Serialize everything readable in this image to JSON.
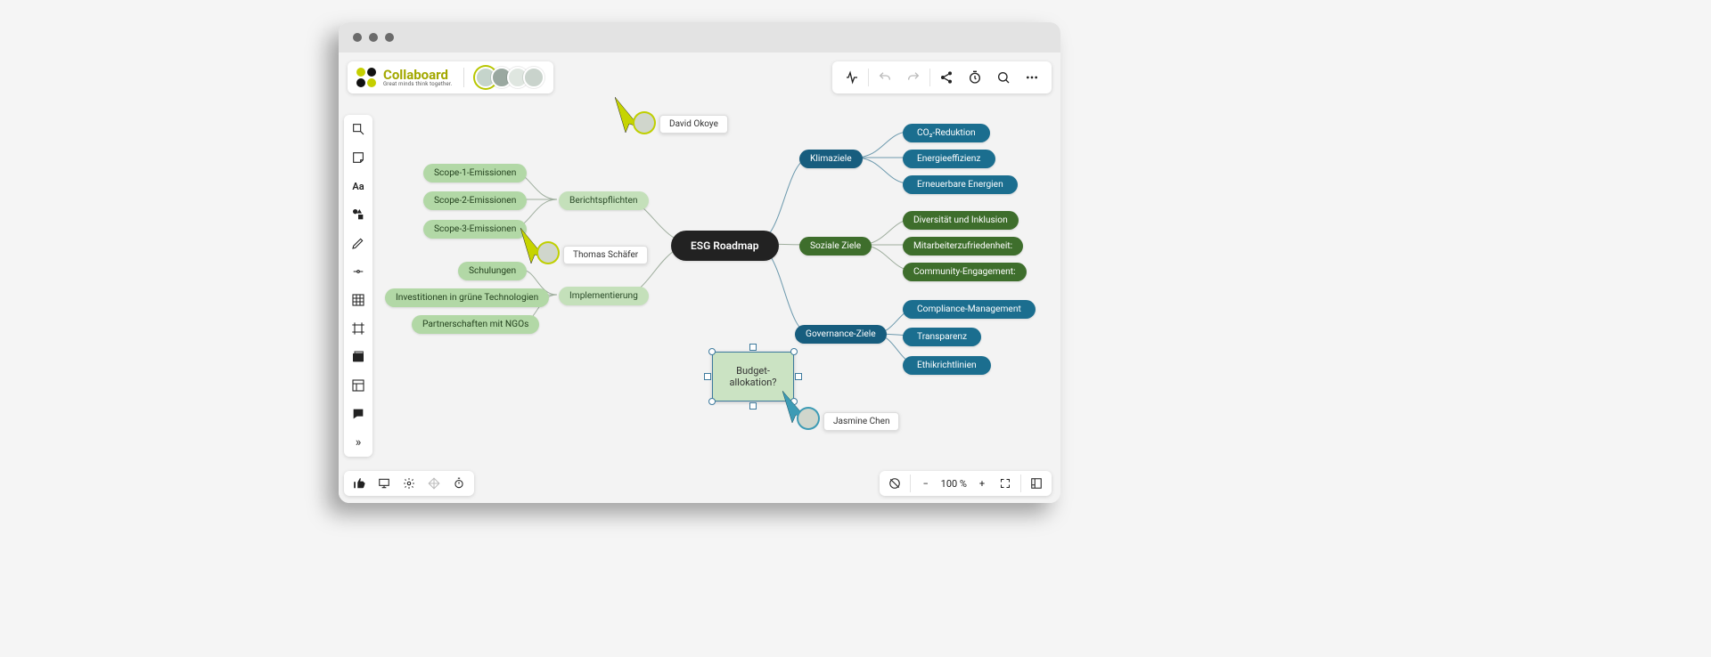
{
  "app": {
    "name": "Collaboard",
    "tagline": "Great minds think together."
  },
  "presence": {
    "avatars": [
      "user1",
      "user2",
      "user3",
      "user4"
    ]
  },
  "toolbar_right": {
    "ai": "ai",
    "undo": "undo",
    "redo": "redo",
    "share": "share",
    "timer": "timer",
    "search": "search",
    "more": "more"
  },
  "left_tools": [
    "select",
    "sticky",
    "text",
    "shapes",
    "pen",
    "connector",
    "table",
    "frame",
    "media",
    "template",
    "comment",
    "expand"
  ],
  "cursors": {
    "david": {
      "name": "David Okoye"
    },
    "thomas": {
      "name": "Thomas Schäfer"
    },
    "jasmine": {
      "name": "Jasmine Chen"
    }
  },
  "mindmap": {
    "center": "ESG Roadmap",
    "left": {
      "berichts": {
        "label": "Berichtspflichten",
        "children": [
          "Scope-1-Emissionen",
          "Scope-2-Emissionen",
          "Scope-3-Emissionen"
        ]
      },
      "impl": {
        "label": "Implementierung",
        "children": [
          "Schulungen",
          "Investitionen in grüne Technologien",
          "Partnerschaften mit NGOs"
        ]
      }
    },
    "right": {
      "klima": {
        "label": "Klimaziele",
        "children": [
          "CO₂-Reduktion",
          "Energieeffizienz",
          "Erneuerbare Energien"
        ]
      },
      "sozial": {
        "label": "Soziale Ziele",
        "children": [
          "Diversität und Inklusion",
          "Mitarbeiterzufriedenheit:",
          "Community-Engagement:"
        ]
      },
      "gov": {
        "label": "Governance-Ziele",
        "children": [
          "Compliance-Management",
          "Transparenz",
          "Ethikrichtlinien"
        ]
      }
    }
  },
  "sticky": {
    "line1": "Budget-",
    "line2": "allokation?"
  },
  "zoom": {
    "value": "100 %"
  }
}
